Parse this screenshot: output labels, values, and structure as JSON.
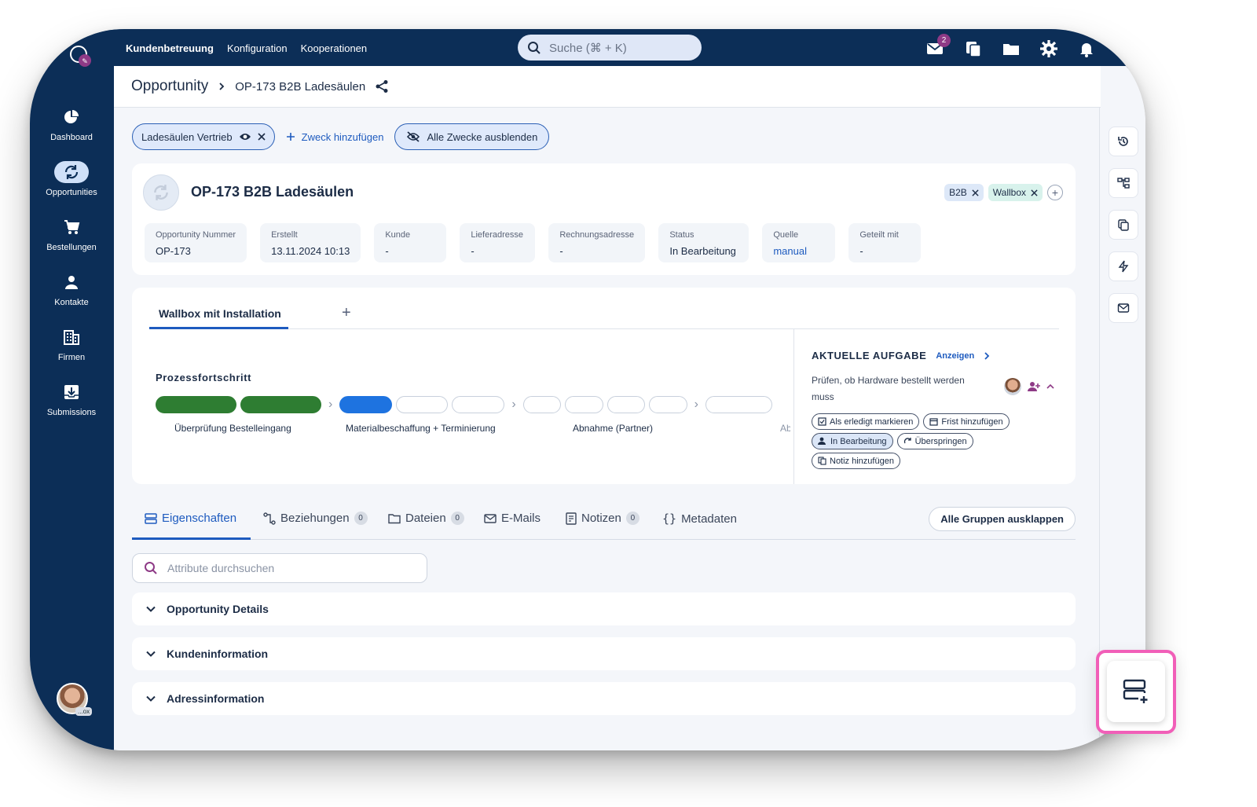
{
  "topbar": {
    "nav": [
      "Kundenbetreuung",
      "Konfiguration",
      "Kooperationen"
    ],
    "search_placeholder": "Suche (⌘ + K)",
    "mail_badge": "2",
    "icons": [
      "mail-icon",
      "copy-icon",
      "folder-icon",
      "gear-icon",
      "bell-icon"
    ]
  },
  "sidebar": {
    "items": [
      {
        "label": "Dashboard",
        "icon": "pie-chart-icon"
      },
      {
        "label": "Opportunities",
        "icon": "refresh-icon",
        "active": true
      },
      {
        "label": "Bestellungen",
        "icon": "cart-icon"
      },
      {
        "label": "Kontakte",
        "icon": "person-icon"
      },
      {
        "label": "Firmen",
        "icon": "building-icon"
      },
      {
        "label": "Submissions",
        "icon": "inbox-download-icon"
      }
    ],
    "avatar_tag": "...ox"
  },
  "breadcrumb": {
    "root": "Opportunity",
    "current": "OP-173 B2B Ladesäulen"
  },
  "purpose_chips": {
    "active_chip": "Ladesäulen Vertrieb",
    "add_label": "Zweck hinzufügen",
    "hide_all_label": "Alle Zwecke ausblenden"
  },
  "opportunity": {
    "title": "OP-173 B2B Ladesäulen",
    "tags": [
      "B2B",
      "Wallbox"
    ],
    "fields": [
      {
        "label": "Opportunity Nummer",
        "value": "OP-173"
      },
      {
        "label": "Erstellt",
        "value": "13.11.2024 10:13"
      },
      {
        "label": "Kunde",
        "value": "-"
      },
      {
        "label": "Lieferadresse",
        "value": "-"
      },
      {
        "label": "Rechnungsadresse",
        "value": "-"
      },
      {
        "label": "Status",
        "value": "In Bearbeitung"
      },
      {
        "label": "Quelle",
        "value": "manual"
      },
      {
        "label": "Geteilt mit",
        "value": "-"
      }
    ]
  },
  "process": {
    "tab_label": "Wallbox mit Installation",
    "progress_label": "Prozessfortschritt",
    "steps": [
      "Überprüfung Bestelleingang",
      "Materialbeschaffung + Terminierung",
      "Abnahme (Partner)",
      "Ab"
    ]
  },
  "task": {
    "heading": "AKTUELLE AUFGABE",
    "show_link": "Anzeigen",
    "text": "Prüfen, ob Hardware bestellt werden muss",
    "actions": [
      "Als erledigt markieren",
      "Frist hinzufügen",
      "In Bearbeitung",
      "Überspringen",
      "Notiz hinzufügen"
    ]
  },
  "detail_tabs": {
    "items": [
      {
        "label": "Eigenschaften"
      },
      {
        "label": "Beziehungen",
        "count": "0"
      },
      {
        "label": "Dateien",
        "count": "0"
      },
      {
        "label": "E-Mails"
      },
      {
        "label": "Notizen",
        "count": "0"
      },
      {
        "label": "Metadaten"
      }
    ],
    "expand_all": "Alle Gruppen ausklappen"
  },
  "attributes": {
    "search_placeholder": "Attribute durchsuchen",
    "groups": [
      "Opportunity Details",
      "Kundeninformation",
      "Adressinformation"
    ]
  },
  "colors": {
    "nav": "#0c2e57",
    "accent": "#1e5bbf",
    "done": "#2e7d32",
    "current": "#1e73e0",
    "highlight": "#f15fb8"
  }
}
